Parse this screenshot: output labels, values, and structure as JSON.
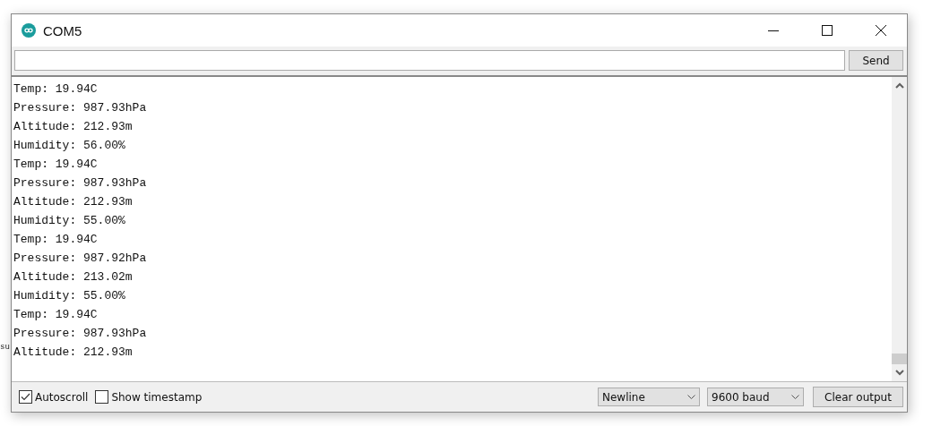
{
  "background_text": "su",
  "window": {
    "title": "COM5"
  },
  "send_button": "Send",
  "output_lines": [
    "Temp: 19.94C",
    "Pressure: 987.93hPa",
    "Altitude: 212.93m",
    "Humidity: 56.00%",
    "Temp: 19.94C",
    "Pressure: 987.93hPa",
    "Altitude: 212.93m",
    "Humidity: 55.00%",
    "Temp: 19.94C",
    "Pressure: 987.92hPa",
    "Altitude: 213.02m",
    "Humidity: 55.00%",
    "Temp: 19.94C",
    "Pressure: 987.93hPa",
    "Altitude: 212.93m"
  ],
  "options": [
    {
      "label": "Autoscroll",
      "checked": true
    },
    {
      "label": "Show timestamp",
      "checked": false
    }
  ],
  "line_ending": "Newline",
  "baud_rate": "9600 baud",
  "clear_button": "Clear output"
}
